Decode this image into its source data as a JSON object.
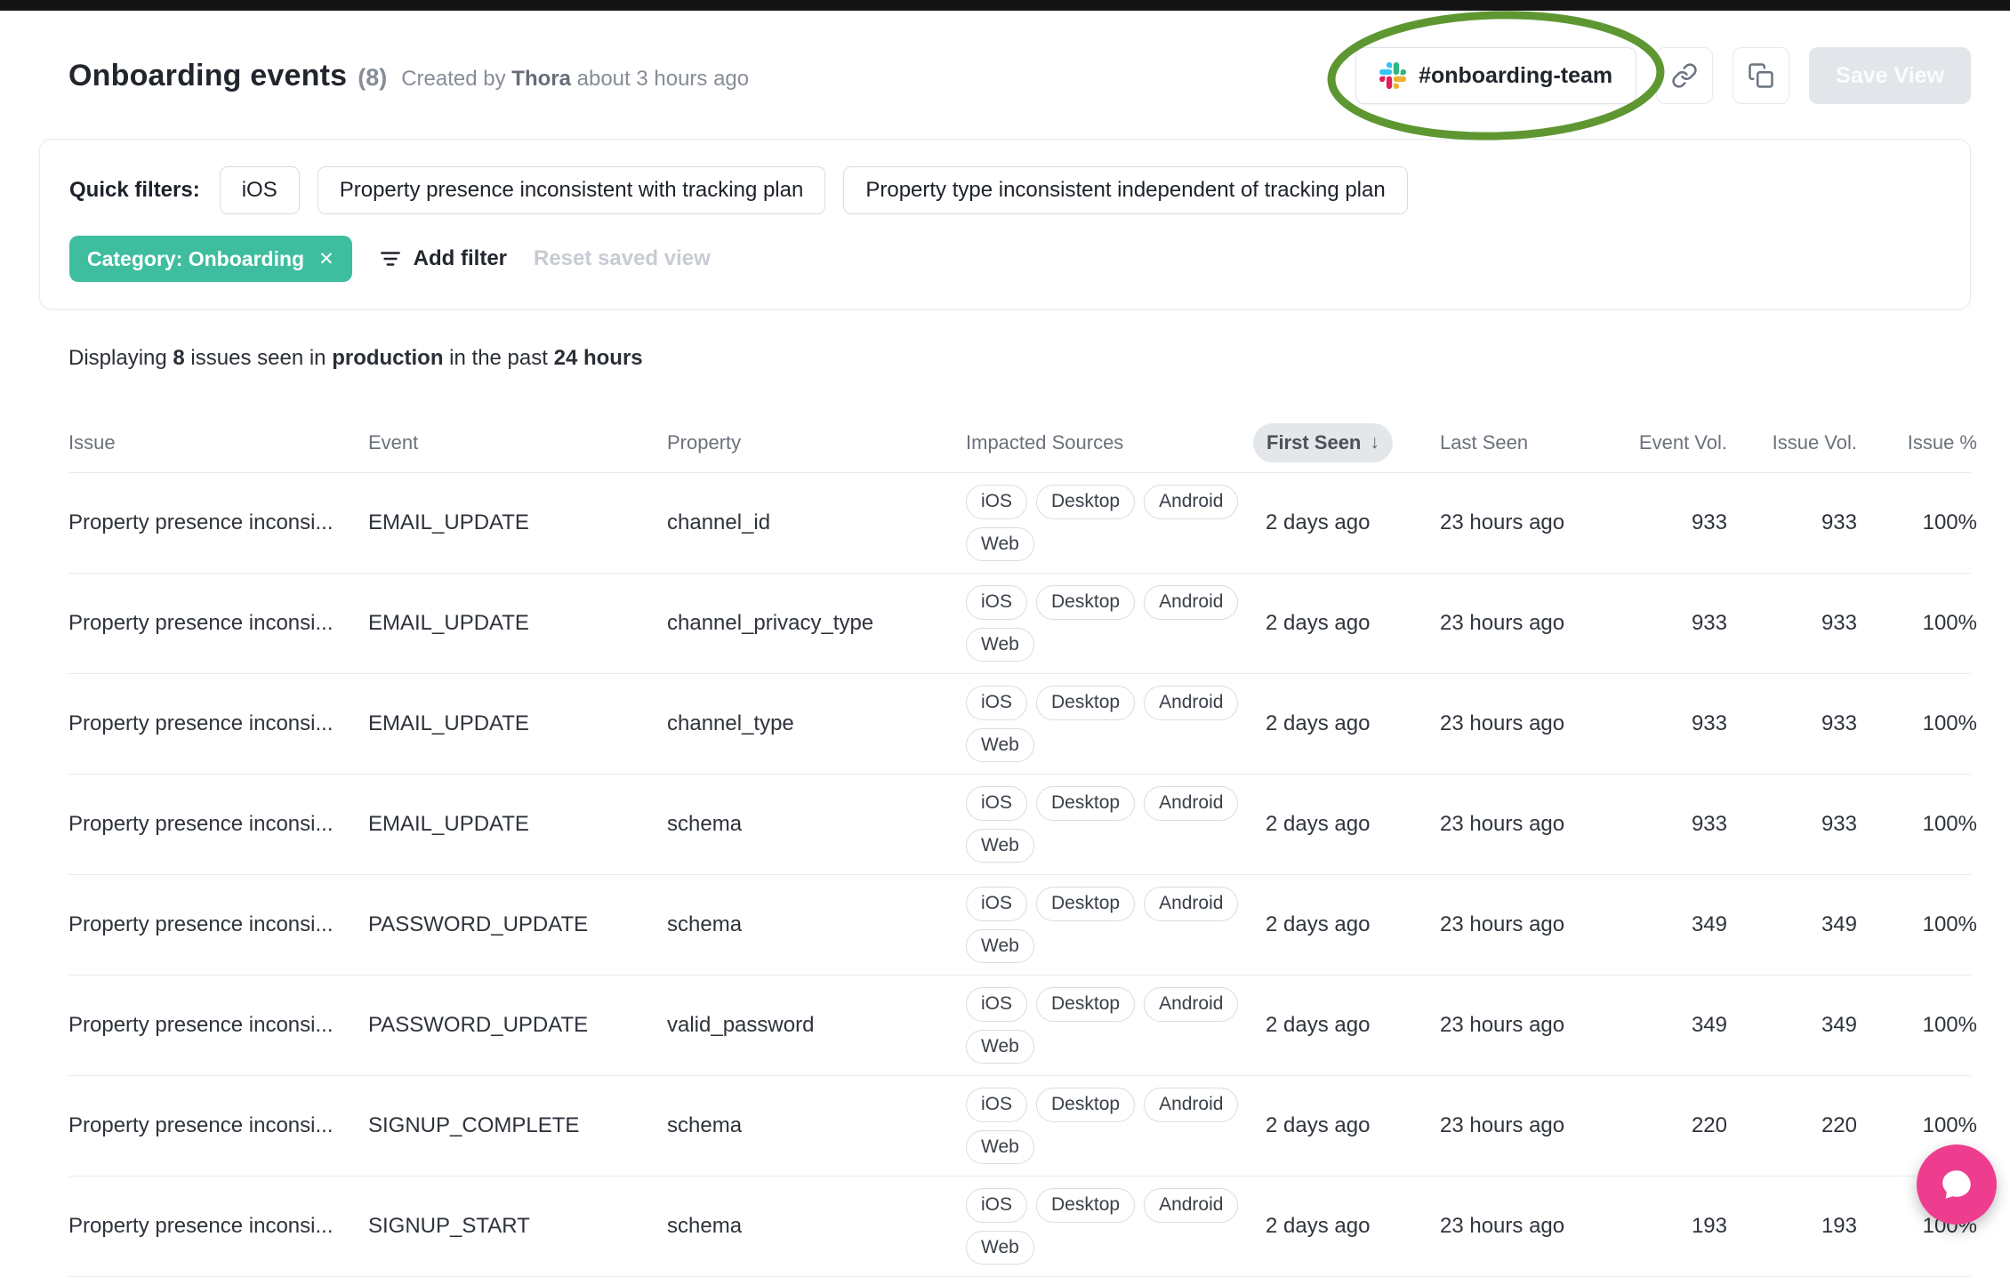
{
  "page": {
    "title": "Onboarding events",
    "count": "(8)",
    "created_prefix": "Created by",
    "created_name": "Thora",
    "created_suffix": "about 3 hours ago"
  },
  "header_actions": {
    "slack_channel": "#onboarding-team",
    "save_view_label": "Save View"
  },
  "filters": {
    "quick_filters_label": "Quick filters:",
    "quick_filters": [
      "iOS",
      "Property presence inconsistent with tracking plan",
      "Property type inconsistent independent of tracking plan"
    ],
    "active_filter": {
      "label": "Category: Onboarding",
      "remove_icon": "✕"
    },
    "add_filter_label": "Add filter",
    "reset_label": "Reset saved view"
  },
  "summary": {
    "prefix": "Displaying",
    "count": "8",
    "mid1": "issues seen in",
    "environment": "production",
    "mid2": "in the past",
    "window": "24 hours"
  },
  "table": {
    "columns": [
      "Issue",
      "Event",
      "Property",
      "Impacted Sources",
      "First Seen",
      "Last Seen",
      "Event Vol.",
      "Issue Vol.",
      "Issue %"
    ],
    "sort_column": "First Seen",
    "sort_icon": "↓",
    "rows": [
      {
        "issue": "Property presence inconsi...",
        "event": "EMAIL_UPDATE",
        "property": "channel_id",
        "sources": [
          "iOS",
          "Desktop",
          "Android",
          "Web"
        ],
        "first_seen": "2 days ago",
        "last_seen": "23 hours ago",
        "event_vol": "933",
        "issue_vol": "933",
        "issue_pct": "100%"
      },
      {
        "issue": "Property presence inconsi...",
        "event": "EMAIL_UPDATE",
        "property": "channel_privacy_type",
        "sources": [
          "iOS",
          "Desktop",
          "Android",
          "Web"
        ],
        "first_seen": "2 days ago",
        "last_seen": "23 hours ago",
        "event_vol": "933",
        "issue_vol": "933",
        "issue_pct": "100%"
      },
      {
        "issue": "Property presence inconsi...",
        "event": "EMAIL_UPDATE",
        "property": "channel_type",
        "sources": [
          "iOS",
          "Desktop",
          "Android",
          "Web"
        ],
        "first_seen": "2 days ago",
        "last_seen": "23 hours ago",
        "event_vol": "933",
        "issue_vol": "933",
        "issue_pct": "100%"
      },
      {
        "issue": "Property presence inconsi...",
        "event": "EMAIL_UPDATE",
        "property": "schema",
        "sources": [
          "iOS",
          "Desktop",
          "Android",
          "Web"
        ],
        "first_seen": "2 days ago",
        "last_seen": "23 hours ago",
        "event_vol": "933",
        "issue_vol": "933",
        "issue_pct": "100%"
      },
      {
        "issue": "Property presence inconsi...",
        "event": "PASSWORD_UPDATE",
        "property": "schema",
        "sources": [
          "iOS",
          "Desktop",
          "Android",
          "Web"
        ],
        "first_seen": "2 days ago",
        "last_seen": "23 hours ago",
        "event_vol": "349",
        "issue_vol": "349",
        "issue_pct": "100%"
      },
      {
        "issue": "Property presence inconsi...",
        "event": "PASSWORD_UPDATE",
        "property": "valid_password",
        "sources": [
          "iOS",
          "Desktop",
          "Android",
          "Web"
        ],
        "first_seen": "2 days ago",
        "last_seen": "23 hours ago",
        "event_vol": "349",
        "issue_vol": "349",
        "issue_pct": "100%"
      },
      {
        "issue": "Property presence inconsi...",
        "event": "SIGNUP_COMPLETE",
        "property": "schema",
        "sources": [
          "iOS",
          "Desktop",
          "Android",
          "Web"
        ],
        "first_seen": "2 days ago",
        "last_seen": "23 hours ago",
        "event_vol": "220",
        "issue_vol": "220",
        "issue_pct": "100%"
      },
      {
        "issue": "Property presence inconsi...",
        "event": "SIGNUP_START",
        "property": "schema",
        "sources": [
          "iOS",
          "Desktop",
          "Android",
          "Web"
        ],
        "first_seen": "2 days ago",
        "last_seen": "23 hours ago",
        "event_vol": "193",
        "issue_vol": "193",
        "issue_pct": "100%"
      }
    ]
  },
  "colors": {
    "accent_teal": "#3EBE9E",
    "annotation_green": "#5E9732",
    "chat_pink": "#EE3D8F",
    "slack_red": "#E01E5A",
    "slack_blue": "#36C5F0",
    "slack_green": "#2EB67D",
    "slack_yellow": "#ECB22E"
  }
}
